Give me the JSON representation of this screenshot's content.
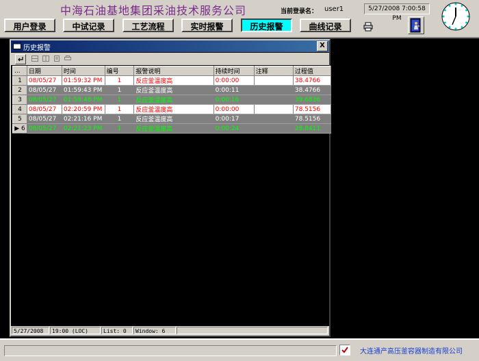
{
  "header": {
    "company_title": "中海石油基地集团采油技术服务公司",
    "login_label": "当前登录名：",
    "login_user": "user1",
    "datetime": "5/27/2008 7:00:58 PM"
  },
  "nav": {
    "user_login": "用户登录",
    "trial_record": "中试记录",
    "process_flow": "工艺流程",
    "realtime_alarm": "实时报警",
    "history_alarm": "历史报警",
    "curve_record": "曲线记录"
  },
  "window": {
    "title": "历史报警",
    "close": "X"
  },
  "table": {
    "headers": {
      "idx": "...",
      "date": "日期",
      "time": "时间",
      "number": "编号",
      "description": "报警说明",
      "duration": "持续时间",
      "comment": "注释",
      "value": "过程值"
    },
    "rows": [
      {
        "idx": "1",
        "date": "08/05/27",
        "time": "01:59:32 PM",
        "number": "1",
        "description": "反应釜温度高",
        "duration": "0:00:00",
        "comment": "",
        "value": "38.4766",
        "state": "alarm"
      },
      {
        "idx": "2",
        "date": "08/05/27",
        "time": "01:59:43 PM",
        "number": "1",
        "description": "反应釜温度高",
        "duration": "0:00:11",
        "comment": "",
        "value": "38.4766",
        "state": "ack"
      },
      {
        "idx": "3",
        "date": "08/05/27",
        "time": "01:59:48 PM",
        "number": "1",
        "description": "反应釜温度高",
        "duration": "0:00:16",
        "comment": "",
        "value": "39.6836",
        "state": "clear"
      },
      {
        "idx": "4",
        "date": "08/05/27",
        "time": "02:20:59 PM",
        "number": "1",
        "description": "反应釜温度高",
        "duration": "0:00:00",
        "comment": "",
        "value": "78.5156",
        "state": "alarm"
      },
      {
        "idx": "5",
        "date": "08/05/27",
        "time": "02:21:16 PM",
        "number": "1",
        "description": "反应釜温度高",
        "duration": "0:00:17",
        "comment": "",
        "value": "78.5156",
        "state": "ack"
      },
      {
        "idx": "▶ 6",
        "date": "08/05/27",
        "time": "02:21:23 PM",
        "number": "1",
        "description": "反应釜温度高",
        "duration": "0:00:24",
        "comment": "",
        "value": "28.8411",
        "state": "clear"
      }
    ]
  },
  "statusbar": {
    "date": "5/27/2008",
    "time": "19:00 (LOC)",
    "list": "List: 0",
    "window": "Window: 6"
  },
  "footer": {
    "company": "大连通产高压釜容器制造有限公司"
  },
  "colors": {
    "alarm_text": "#ff0000",
    "ack_text": "#ffffff",
    "clear_text": "#00ff00",
    "active_nav": "#00ffff",
    "title_purple": "#7a2a8a"
  }
}
